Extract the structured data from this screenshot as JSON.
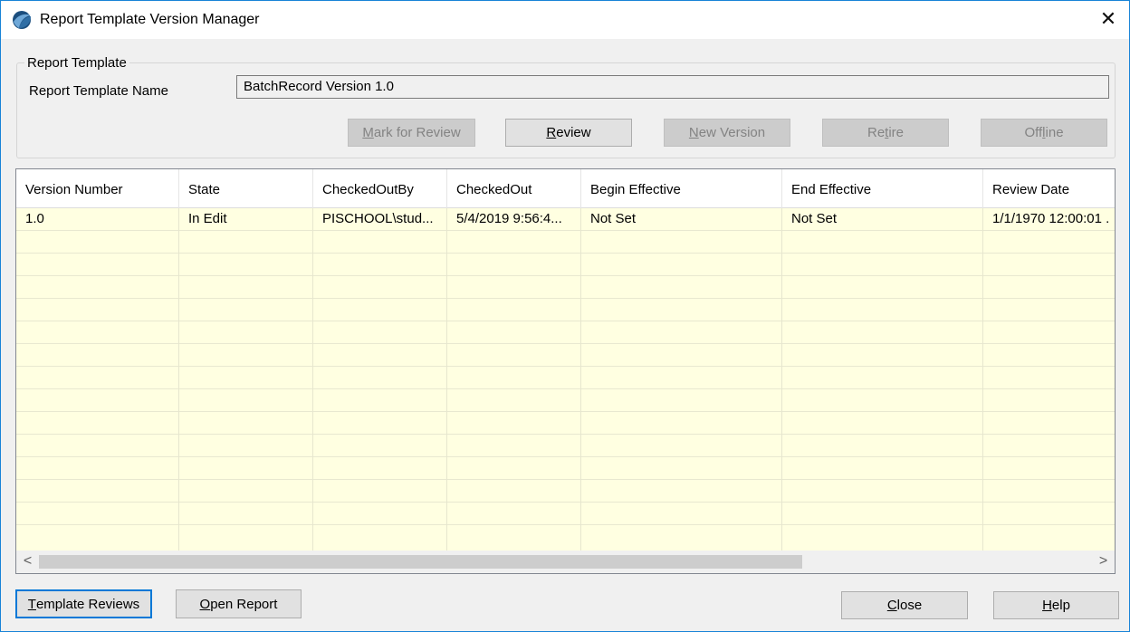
{
  "window": {
    "title": "Report Template Version Manager",
    "close_glyph": "✕"
  },
  "report_template": {
    "group_label": "Report Template",
    "name_label": "Report Template Name",
    "name_value": "BatchRecord Version 1.0"
  },
  "actions": {
    "mark_for_review": {
      "pre": "",
      "key": "M",
      "post": "ark for Review",
      "enabled": false
    },
    "review": {
      "pre": "",
      "key": "R",
      "post": "eview",
      "enabled": true
    },
    "new_version": {
      "pre": "",
      "key": "N",
      "post": "ew Version",
      "enabled": false
    },
    "retire": {
      "pre": "Re",
      "key": "t",
      "post": "ire",
      "enabled": false
    },
    "offline": {
      "pre": "Off",
      "key": "l",
      "post": "ine",
      "enabled": false
    }
  },
  "grid": {
    "columns": [
      "Version Number",
      "State",
      "CheckedOutBy",
      "CheckedOut",
      "Begin Effective",
      "End Effective",
      "Review Date"
    ],
    "rows": [
      [
        "1.0",
        "In Edit",
        "PISCHOOL\\stud...",
        "5/4/2019 9:56:4...",
        "Not Set",
        "Not Set",
        "1/1/1970 12:00:01 ."
      ]
    ],
    "scroll_left": "<",
    "scroll_right": ">"
  },
  "footer": {
    "template_reviews": {
      "pre": "",
      "key": "T",
      "post": "emplate Reviews"
    },
    "open_report": {
      "pre": "",
      "key": "O",
      "post": "pen Report"
    },
    "close": {
      "pre": "",
      "key": "C",
      "post": "lose"
    },
    "help": {
      "pre": "",
      "key": "H",
      "post": "elp"
    }
  },
  "colors": {
    "grid_background": "#ffffe1",
    "accent": "#0078d7",
    "disabled_text": "#838383"
  },
  "icons": {
    "app": "pi-app-icon",
    "close": "close-icon"
  }
}
